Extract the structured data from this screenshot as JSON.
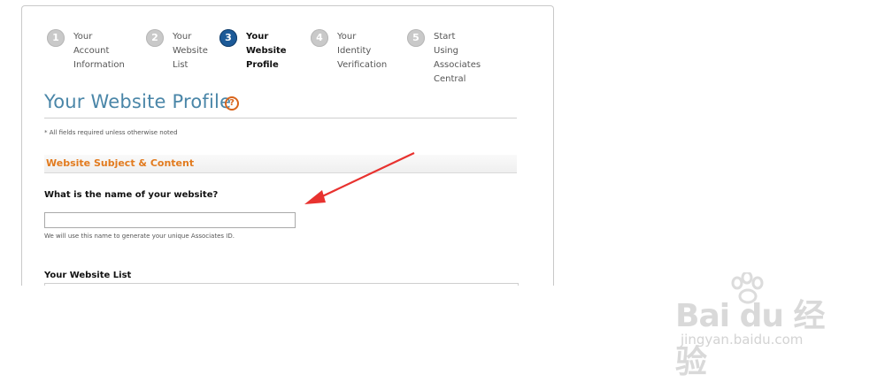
{
  "steps": [
    {
      "number": "1",
      "label_lines": [
        "Your Account",
        "Information"
      ],
      "active": false
    },
    {
      "number": "2",
      "label_lines": [
        "Your",
        "Website",
        "List"
      ],
      "active": false
    },
    {
      "number": "3",
      "label_lines": [
        "Your Website",
        "Profile"
      ],
      "active": true
    },
    {
      "number": "4",
      "label_lines": [
        "Your Identity",
        "Verification"
      ],
      "active": false
    },
    {
      "number": "5",
      "label_lines": [
        "Start Using",
        "Associates Central"
      ],
      "active": false
    }
  ],
  "main": {
    "title": "Your Website Profile",
    "help_icon_glyph": "?",
    "required_note": "* All fields required unless otherwise noted",
    "section_title": "Website Subject & Content",
    "question": "What is the name of your website?",
    "website_name_value": "",
    "hint": "We will use this name to generate your unique Associates ID.",
    "list_title": "Your Website List"
  },
  "watermark": {
    "logo_text": "Bai du 经验",
    "url": "jingyan.baidu.com"
  },
  "colors": {
    "active_step": "#1c5a98",
    "inactive_step": "#c9c9c9",
    "title": "#4a86a8",
    "section_title": "#e27b1f",
    "help_icon": "#d9651c",
    "arrow": "#e8322f"
  }
}
